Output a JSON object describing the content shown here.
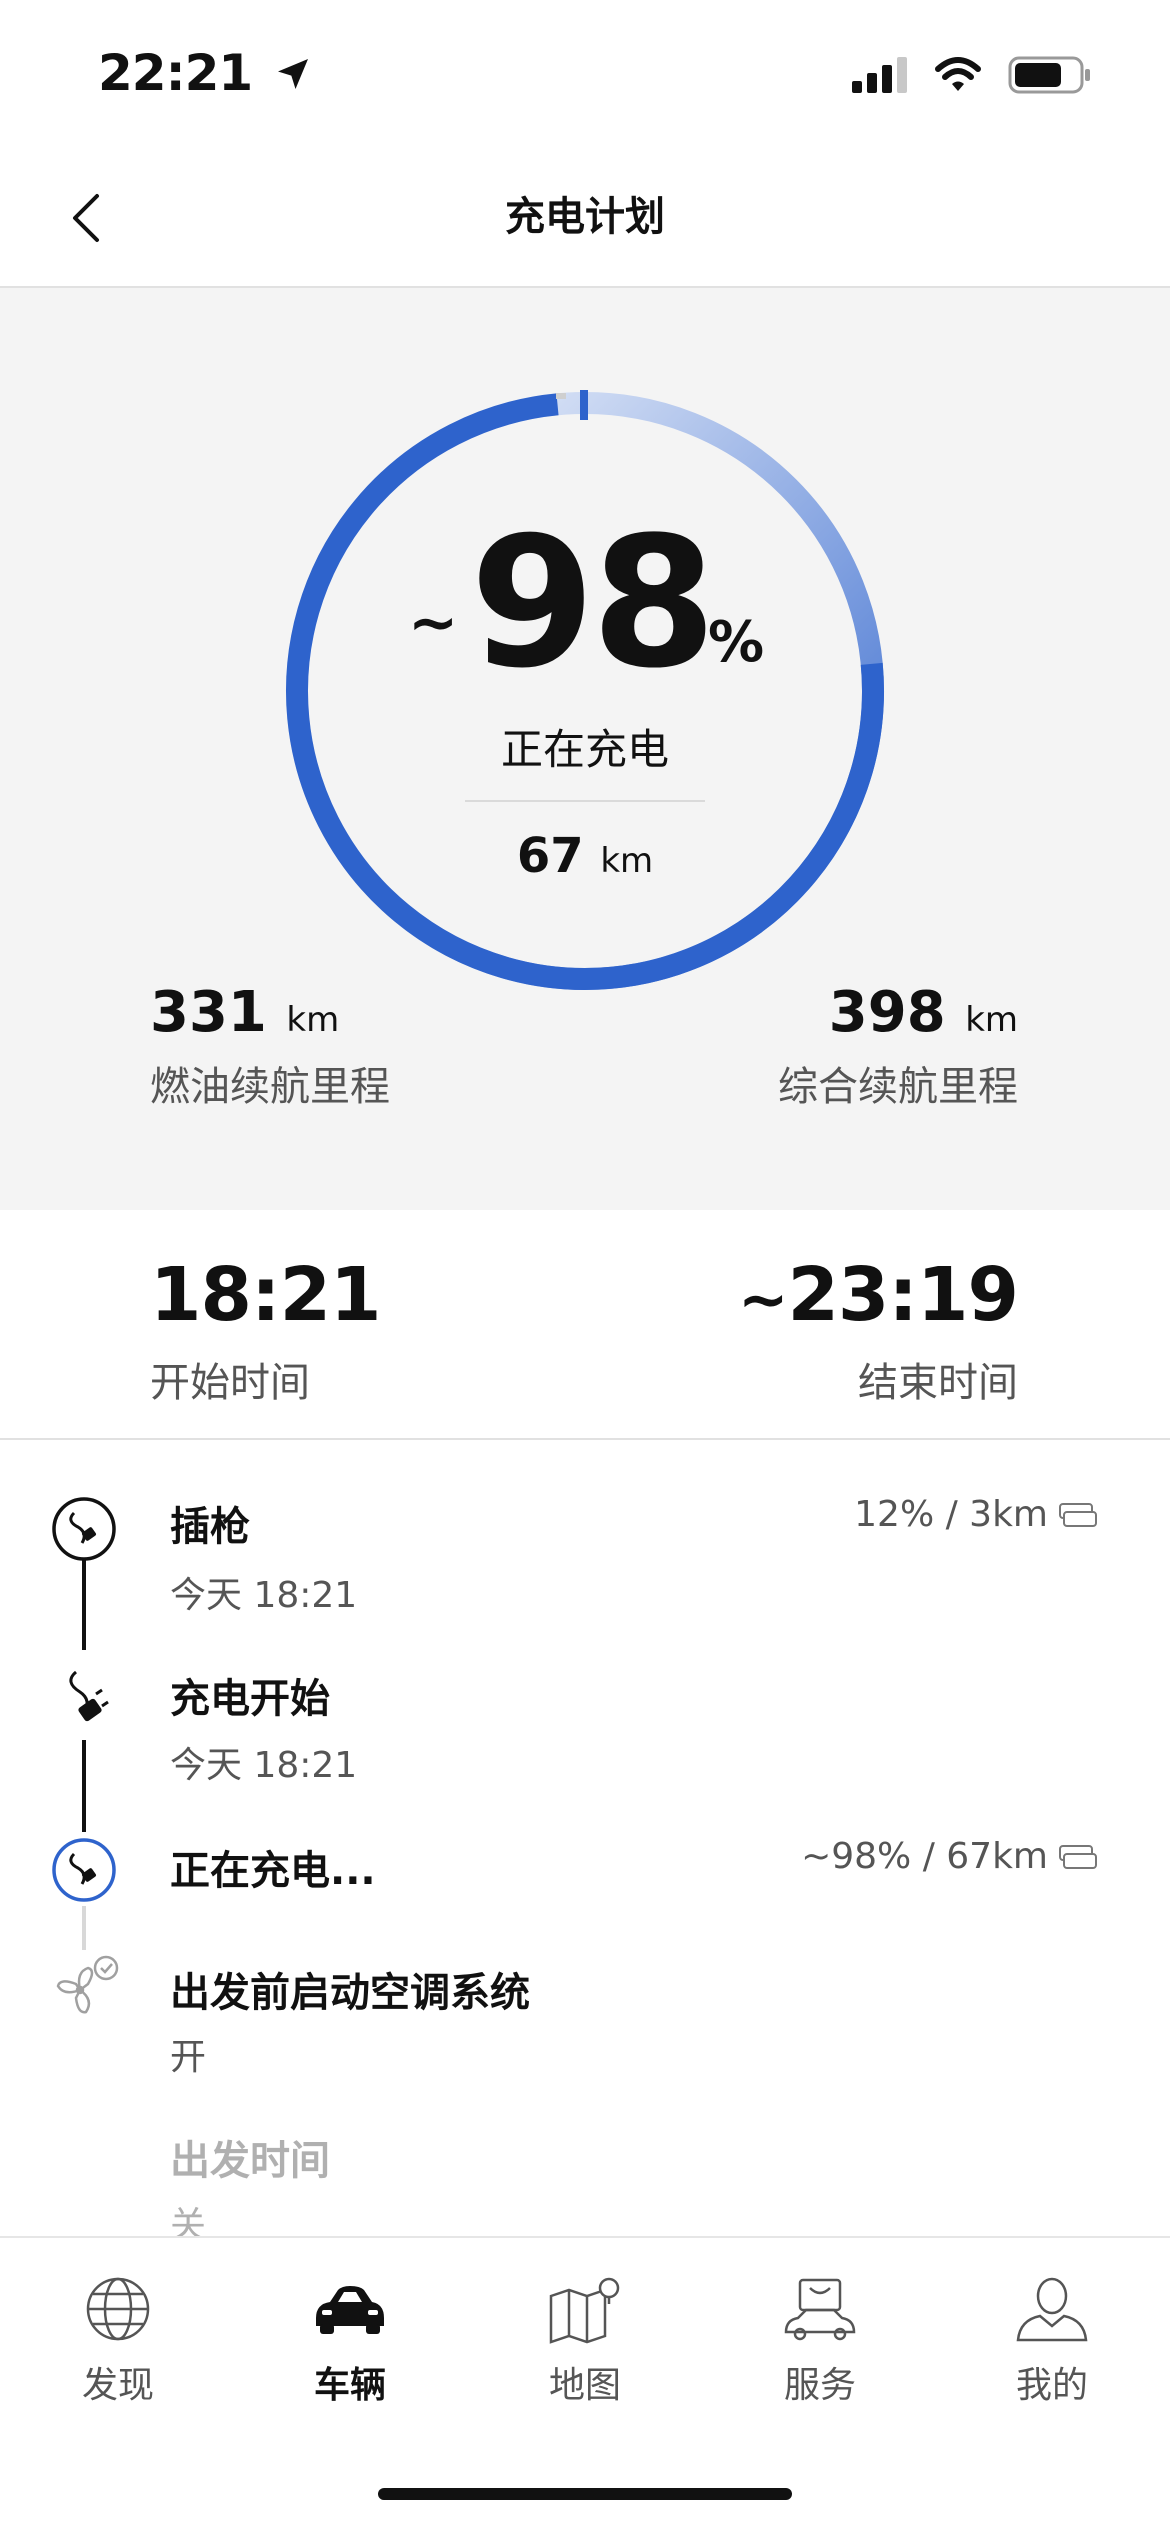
{
  "status_bar": {
    "time": "22:21"
  },
  "header": {
    "title": "充电计划"
  },
  "charge": {
    "approx": "~",
    "percent": "98",
    "percent_sign": "%",
    "level": 0.98,
    "status": "正在充电",
    "electric_range_value": "67",
    "electric_range_unit": "km",
    "fuel_range_value": "331",
    "fuel_range_unit": "km",
    "fuel_range_label": "燃油续航里程",
    "combined_range_value": "398",
    "combined_range_unit": "km",
    "combined_range_label": "综合续航里程",
    "ring_color": "#2e63cc"
  },
  "times": {
    "start_value": "18:21",
    "start_label": "开始时间",
    "end_approx": "~",
    "end_value": "23:19",
    "end_label": "结束时间"
  },
  "timeline": [
    {
      "title": "插枪",
      "subtitle": "今天 18:21",
      "right": "12% / 3km"
    },
    {
      "title": "充电开始",
      "subtitle": "今天 18:21"
    },
    {
      "title": "正在充电...",
      "right": "~98% / 67km"
    },
    {
      "title": "出发前启动空调系统",
      "subtitle": "开"
    },
    {
      "title": "出发时间",
      "subtitle": "关"
    }
  ],
  "tabs": [
    {
      "label": "发现",
      "icon": "globe-icon"
    },
    {
      "label": "车辆",
      "icon": "car-icon",
      "active": true
    },
    {
      "label": "地图",
      "icon": "map-icon"
    },
    {
      "label": "服务",
      "icon": "service-icon"
    },
    {
      "label": "我的",
      "icon": "profile-icon"
    }
  ]
}
